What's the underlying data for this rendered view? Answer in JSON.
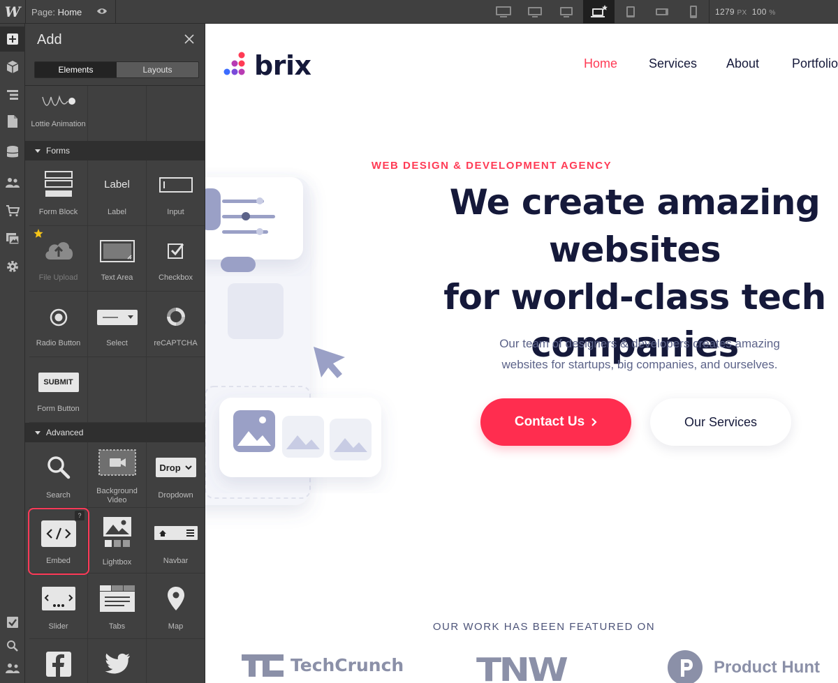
{
  "topbar": {
    "logo": "W",
    "page_prefix": "Page:",
    "page_name": "Home",
    "width_value": "1279",
    "width_unit": "PX",
    "zoom_value": "100",
    "zoom_unit": "%",
    "breakpoints": [
      "desktop-xl-icon",
      "desktop-l-icon",
      "desktop-m-icon",
      "desktop-base-icon",
      "tablet-icon",
      "mobile-landscape-icon",
      "mobile-portrait-icon"
    ]
  },
  "rail": {
    "icons": [
      "add-icon",
      "navigator-icon",
      "layers-icon",
      "pages-icon",
      "cms-icon",
      "users-icon",
      "ecommerce-icon",
      "assets-icon",
      "settings-icon"
    ],
    "bottom_icons": [
      "audit-icon",
      "search-icon",
      "collaborators-icon"
    ]
  },
  "panel": {
    "title": "Add",
    "tabs": [
      {
        "label": "Elements",
        "active": true
      },
      {
        "label": "Layouts",
        "active": false
      }
    ],
    "sections": {
      "forms": "Forms",
      "advanced": "Advanced"
    },
    "items": {
      "lottie": "Lottie Animation",
      "form_block": "Form Block",
      "label": "Label",
      "label_icon_text": "Label",
      "input": "Input",
      "file_upload": "File Upload",
      "text_area": "Text Area",
      "checkbox": "Checkbox",
      "radio": "Radio Button",
      "select": "Select",
      "recaptcha": "reCAPTCHA",
      "submit_icon_text": "SUBMIT",
      "form_button": "Form Button",
      "search": "Search",
      "bg_video": "Background Video",
      "dropdown_icon_text": "Drop",
      "dropdown": "Dropdown",
      "embed": "Embed",
      "embed_badge": "?",
      "lightbox": "Lightbox",
      "navbar": "Navbar",
      "slider": "Slider",
      "tabs": "Tabs",
      "map": "Map"
    }
  },
  "site": {
    "brand": "brix",
    "nav": [
      {
        "label": "Home",
        "active": true
      },
      {
        "label": "Services"
      },
      {
        "label": "About"
      },
      {
        "label": "Portfolio"
      }
    ],
    "eyebrow": "WEB DESIGN & DEVELOPMENT AGENCY",
    "headline": [
      "We create amazing websites",
      "for world-class tech",
      "companies"
    ],
    "subtitle": [
      "Our team of designers & developers creates amazing",
      "websites for startups, big companies, and ourselves."
    ],
    "cta_primary": "Contact Us",
    "cta_secondary": "Our Services",
    "featured_label": "OUR WORK HAS BEEN FEATURED ON",
    "press": [
      "TechCrunch",
      "TNW",
      "Product Hunt"
    ]
  },
  "colors": {
    "accent": "#ff2d4f",
    "navy": "#15193a",
    "editor_bg": "#404040",
    "highlight": "#ff3a58"
  }
}
